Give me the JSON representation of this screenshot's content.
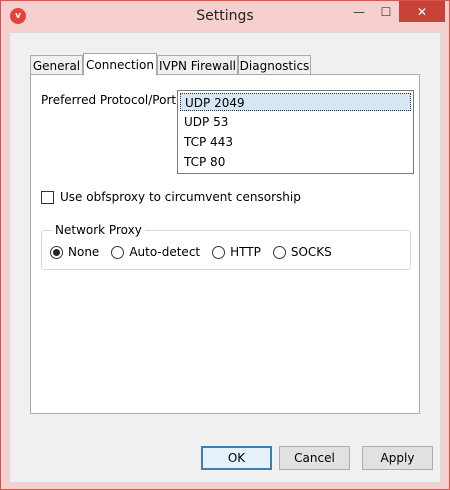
{
  "window": {
    "title": "Settings",
    "app_icon": "v",
    "controls": {
      "minimize": "—",
      "maximize": "☐",
      "close": "✕"
    }
  },
  "tabs": [
    {
      "label": "General"
    },
    {
      "label": "Connection"
    },
    {
      "label": "IVPN Firewall"
    },
    {
      "label": "Diagnostics"
    }
  ],
  "active_tab": "Connection",
  "connection": {
    "preferred_label": "Preferred Protocol/Port:",
    "protocols": [
      {
        "label": "UDP 2049",
        "selected": true
      },
      {
        "label": "UDP 53",
        "selected": false
      },
      {
        "label": "TCP 443",
        "selected": false
      },
      {
        "label": "TCP 80",
        "selected": false
      }
    ],
    "obfsproxy_label": "Use obfsproxy to circumvent censorship",
    "obfsproxy_checked": false,
    "network_proxy": {
      "legend": "Network Proxy",
      "options": [
        {
          "label": "None",
          "selected": true
        },
        {
          "label": "Auto-detect",
          "selected": false
        },
        {
          "label": "HTTP",
          "selected": false
        },
        {
          "label": "SOCKS",
          "selected": false
        }
      ]
    }
  },
  "buttons": {
    "ok": "OK",
    "cancel": "Cancel",
    "apply": "Apply"
  }
}
